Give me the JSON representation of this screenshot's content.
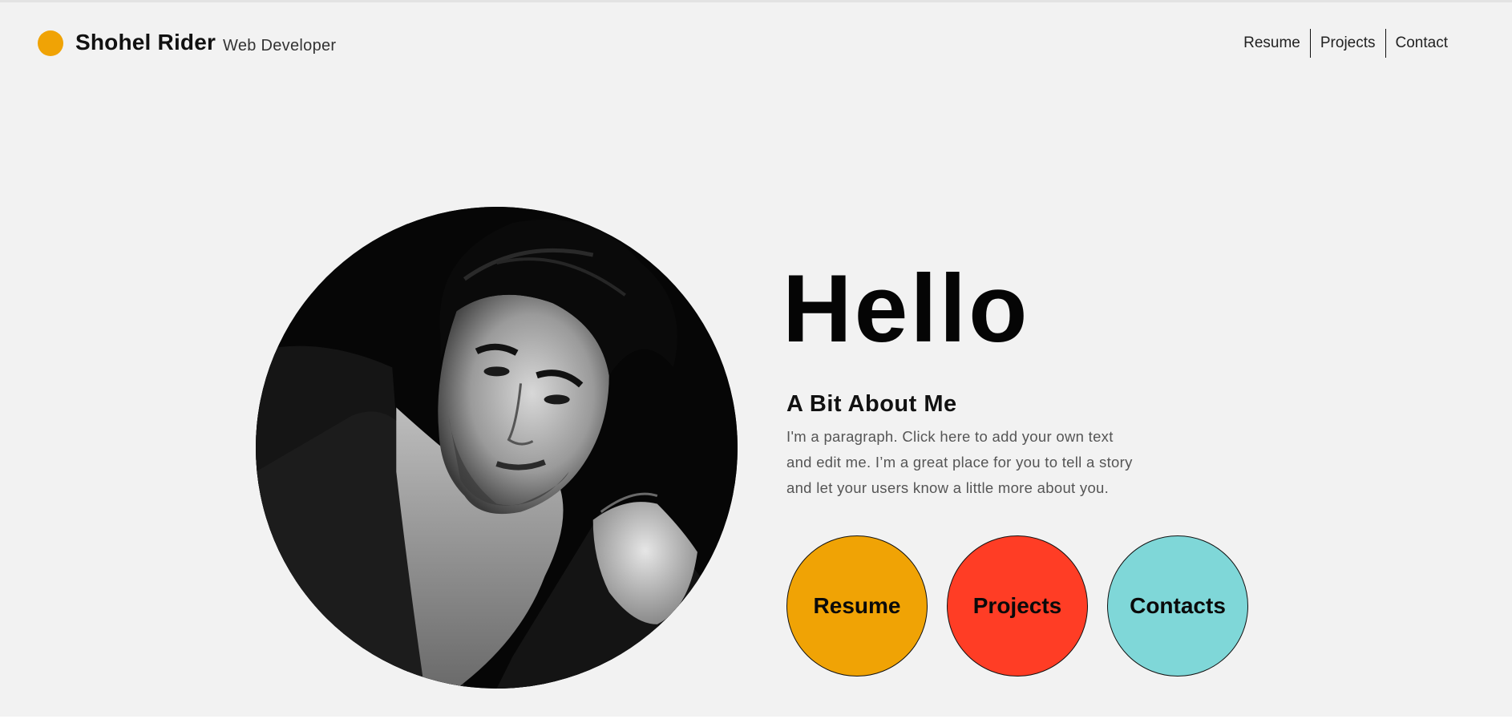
{
  "header": {
    "brand_name": "Shohel Rider",
    "tagline": "Web Developer",
    "nav": [
      "Resume",
      "Projects",
      "Contact"
    ]
  },
  "hero": {
    "heading": "Hello",
    "about_title": "A Bit About Me",
    "about_lines": [
      "I'm a paragraph. Click here to add your own text",
      "and edit me. I’m a great place for you to tell a story",
      "and let your users know a little more about you."
    ],
    "portrait": "black-and-white-portrait"
  },
  "buttons": [
    {
      "label": "Resume",
      "color": "#f0a305"
    },
    {
      "label": "Projects",
      "color": "#ff3d25"
    },
    {
      "label": "Contacts",
      "color": "#7fd7d8"
    }
  ],
  "colors": {
    "accent": "#f0a305",
    "background": "#f2f2f2"
  }
}
